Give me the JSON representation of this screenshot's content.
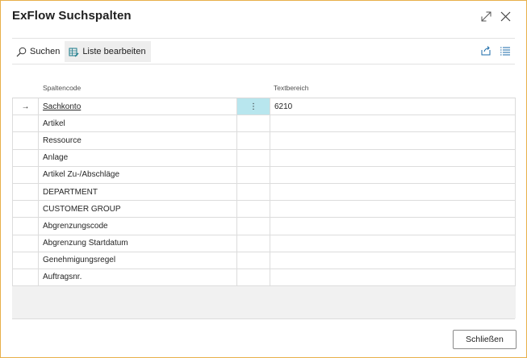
{
  "dialog": {
    "title": "ExFlow Suchspalten",
    "expand_icon": "expand-icon",
    "close_icon": "close-icon"
  },
  "toolbar": {
    "search_label": "Suchen",
    "edit_list_label": "Liste bearbeiten",
    "share_icon": "share-icon",
    "list_view_icon": "list-view-icon"
  },
  "columns": {
    "code": "Spaltencode",
    "text": "Textbereich"
  },
  "rows": [
    {
      "code": "Sachkonto",
      "text": "6210"
    },
    {
      "code": "Artikel",
      "text": ""
    },
    {
      "code": "Ressource",
      "text": ""
    },
    {
      "code": "Anlage",
      "text": ""
    },
    {
      "code": "Artikel Zu-/Abschläge",
      "text": ""
    },
    {
      "code": "DEPARTMENT",
      "text": ""
    },
    {
      "code": "CUSTOMER GROUP",
      "text": ""
    },
    {
      "code": "Abgrenzungscode",
      "text": ""
    },
    {
      "code": "Abgrenzung Startdatum",
      "text": ""
    },
    {
      "code": "Genehmigungsregel",
      "text": ""
    },
    {
      "code": "Auftragsnr.",
      "text": ""
    }
  ],
  "current_row_marker": "→",
  "row_menu_glyph": "⋮",
  "accent_color": "#b8e6ee",
  "footer": {
    "close_label": "Schließen"
  }
}
